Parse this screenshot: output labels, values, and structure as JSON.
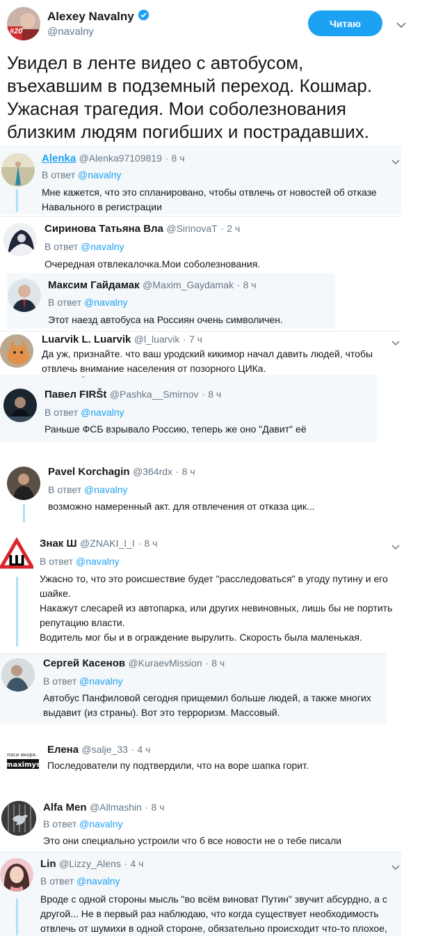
{
  "main": {
    "name": "Alexey Navalny",
    "handle": "@navalny",
    "follow_label": "Читаю",
    "avatar_badge": "#20",
    "text": [
      "Увидел в ленте видео с автобусом,",
      "въехавшим в подземный переход. Кошмар.",
      "Ужасная трагедия. Мои соболезнования",
      "близким людям погибших и пострадавших."
    ]
  },
  "replies": [
    {
      "name": "Alenka",
      "handle": "@Alenka97109819",
      "time": "8 ч",
      "reply_label": "В ответ",
      "reply_to": "@navalny",
      "text": [
        "Мне кажется, что это спланировано, чтобы отвлечь от новостей об отказе",
        "Навального в регистрации"
      ]
    },
    {
      "name": "Сиринова Татьяна Вла",
      "handle": "@SirinovaT",
      "time": "2 ч",
      "reply_label": "В ответ",
      "reply_to": "@navalny",
      "text": [
        "Очередная отвлекалочка.Мои соболезнования."
      ]
    },
    {
      "name": "Максим Гайдамак",
      "handle": "@Maxim_Gaydamak",
      "time": "8 ч",
      "reply_label": "В ответ",
      "reply_to": "@navalny",
      "text": [
        "Этот наезд автобуса на Россиян очень символичен."
      ]
    },
    {
      "name": "Luarvik L. Luarvik",
      "handle": "@l_luarvik",
      "time": "7 ч",
      "reply_label": "",
      "reply_to": "",
      "text": [
        "Да уж, признайте. что ваш уродский кикимор начал давить людей, чтобы",
        "отвлечь внимание населения от позорного ЦИКа."
      ]
    },
    {
      "name": "Павел FIRŠt",
      "handle": "@Pashka__Smirnov",
      "time": "8 ч",
      "reply_label": "В ответ",
      "reply_to": "@navalny",
      "text": [
        "Раньше ФСБ взрывало Россию, теперь же оно \"Давит\" её"
      ]
    },
    {
      "name": "Pavel Korchagin",
      "handle": "@364rdx",
      "time": "8 ч",
      "reply_label": "В ответ",
      "reply_to": "@navalny",
      "text": [
        "возможно намеренный акт. для отвлечения от отказа цик..."
      ]
    },
    {
      "name": "Знак Ш",
      "handle": "@ZNAKI_I_I",
      "time": "8 ч",
      "reply_label": "В ответ",
      "reply_to": "@navalny",
      "text": [
        "Ужасно то, что это роисшествие будет \"расследоваться\" в угоду путину и его",
        "шайке.",
        "Накажут слесарей из автопарка, или других невиновных, лишь бы не портить",
        "репутацию власти.",
        "Водитель мог бы и в ограждение вырулить. Скорость была маленькая."
      ]
    },
    {
      "name": "Сергей Касенов",
      "handle": "@KuraevMission",
      "time": "8 ч",
      "reply_label": "В ответ",
      "reply_to": "@navalny",
      "text": [
        "Автобус Панфиловой сегодня прищемил больше людей, а также многих",
        "выдавит (из страны). Вот это терроризм. Массовый."
      ]
    },
    {
      "name": "Елена",
      "handle": "@salje_33",
      "time": "4 ч",
      "reply_label": "",
      "reply_to": "",
      "avatar_text": [
        "паси якоря.",
        "maximys"
      ],
      "text": [
        "Последователи пу подтвердили, что на воре шапка горит."
      ]
    },
    {
      "name": "Alfa Men",
      "handle": "@Allmashin",
      "time": "8 ч",
      "reply_label": "В ответ",
      "reply_to": "@navalny",
      "text": [
        "Это они специально устроили что б все новости не о тебе писали"
      ]
    },
    {
      "name": "Lin",
      "handle": "@Lizzy_Alens",
      "time": "4 ч",
      "reply_label": "В ответ",
      "reply_to": "@navalny",
      "text": [
        "Вроде с одной стороны мысль \"во всём виноват Путин\" звучит абсурдно, а с",
        "другой... Не в первый раз наблюдаю, что когда существует необходимость",
        "отвлечь от шумихи в одной стороне, обязательно происходит что-то плохое,"
      ]
    }
  ],
  "dot": "·",
  "colors": {
    "accent": "#1da1f2",
    "thread_line": "#aee0fc",
    "card_bg": "#f5f8fa"
  }
}
